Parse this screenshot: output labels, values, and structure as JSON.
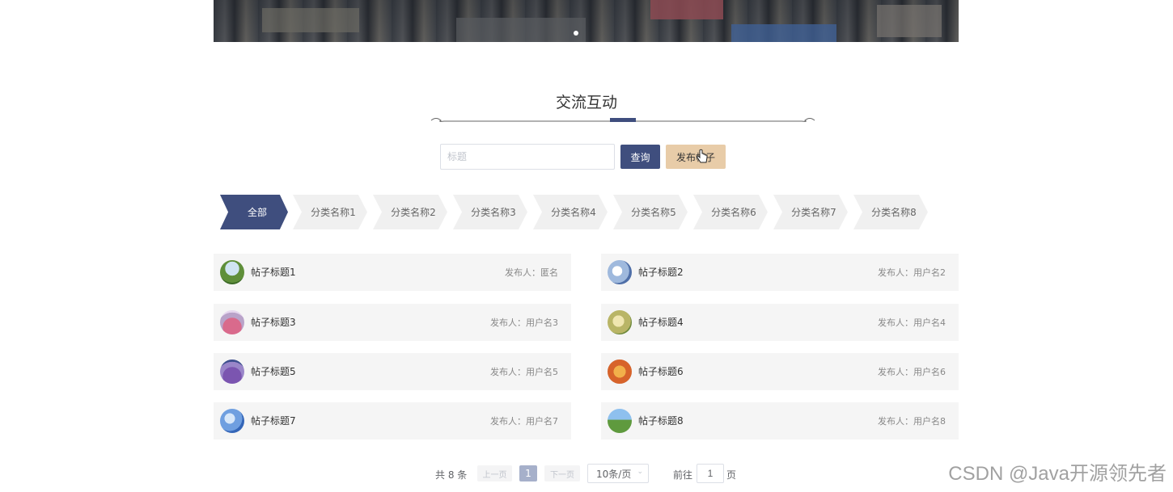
{
  "section": {
    "title": "交流互动"
  },
  "search": {
    "placeholder": "标题",
    "value": "",
    "query_label": "查询",
    "post_label": "发布帖子"
  },
  "categories": [
    {
      "label": "全部",
      "active": true
    },
    {
      "label": "分类名称1",
      "active": false
    },
    {
      "label": "分类名称2",
      "active": false
    },
    {
      "label": "分类名称3",
      "active": false
    },
    {
      "label": "分类名称4",
      "active": false
    },
    {
      "label": "分类名称5",
      "active": false
    },
    {
      "label": "分类名称6",
      "active": false
    },
    {
      "label": "分类名称7",
      "active": false
    },
    {
      "label": "分类名称8",
      "active": false
    }
  ],
  "posts": [
    {
      "title": "帖子标题1",
      "author": "发布人：匿名"
    },
    {
      "title": "帖子标题2",
      "author": "发布人：用户名2"
    },
    {
      "title": "帖子标题3",
      "author": "发布人：用户名3"
    },
    {
      "title": "帖子标题4",
      "author": "发布人：用户名4"
    },
    {
      "title": "帖子标题5",
      "author": "发布人：用户名5"
    },
    {
      "title": "帖子标题6",
      "author": "发布人：用户名6"
    },
    {
      "title": "帖子标题7",
      "author": "发布人：用户名7"
    },
    {
      "title": "帖子标题8",
      "author": "发布人：用户名8"
    }
  ],
  "pagination": {
    "total_text": "共 8 条",
    "prev_label": "上一页",
    "current_page": "1",
    "next_label": "下一页",
    "page_size": "10条/页",
    "goto_label": "前往",
    "goto_value": "1",
    "goto_suffix": "页"
  },
  "watermark": "CSDN @Java开源领先者",
  "colors": {
    "primary": "#3f4e7e",
    "post_button": "#e8cca8",
    "card_bg": "#f5f5f5"
  }
}
